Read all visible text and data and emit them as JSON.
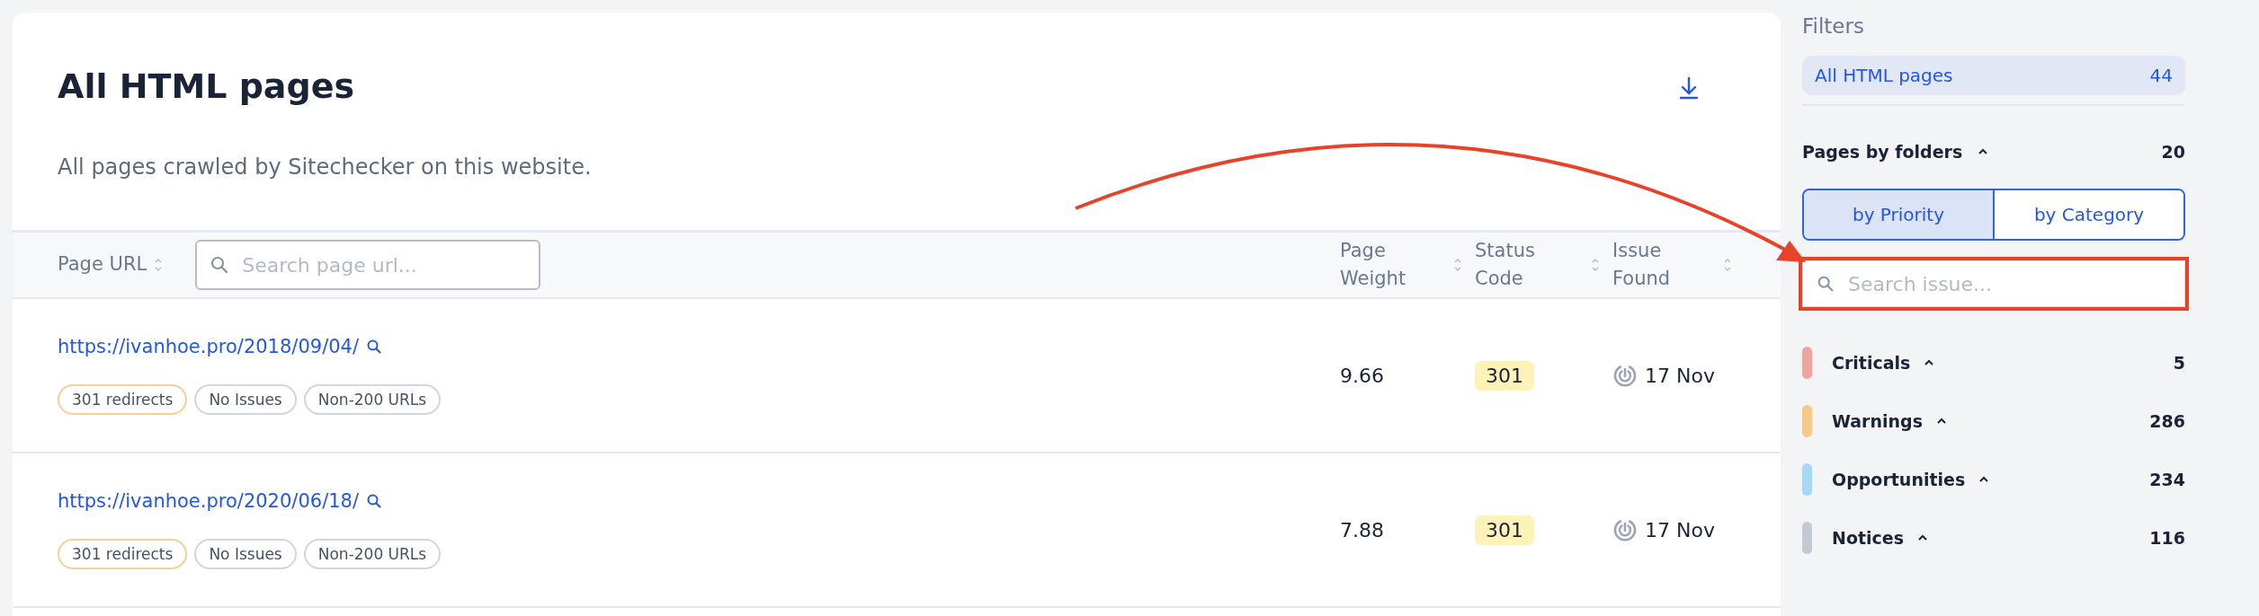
{
  "main": {
    "title": "All HTML pages",
    "subtitle": "All pages crawled by Sitechecker on this website."
  },
  "table": {
    "columns": [
      {
        "label": "Page URL",
        "sortable": true
      },
      {
        "label": "Page Weight",
        "sortable": true
      },
      {
        "label": "Status Code",
        "sortable": true
      },
      {
        "label": "Issue Found",
        "sortable": true
      }
    ],
    "search": {
      "placeholder": "Search page url..."
    },
    "rows": [
      {
        "url": "https://ivanhoe.pro/2018/09/04/",
        "tags": [
          {
            "label": "301 redirects",
            "kind": "warning"
          },
          {
            "label": "No Issues",
            "kind": "neutral"
          },
          {
            "label": "Non-200 URLs",
            "kind": "neutral"
          }
        ],
        "weight": "9.66",
        "status": "301",
        "found": "17 Nov"
      },
      {
        "url": "https://ivanhoe.pro/2020/06/18/",
        "tags": [
          {
            "label": "301 redirects",
            "kind": "warning"
          },
          {
            "label": "No Issues",
            "kind": "neutral"
          },
          {
            "label": "Non-200 URLs",
            "kind": "neutral"
          }
        ],
        "weight": "7.88",
        "status": "301",
        "found": "17 Nov"
      }
    ]
  },
  "sidebar": {
    "title": "Filters",
    "all_pages": {
      "label": "All HTML pages",
      "count": "44",
      "selected": true
    },
    "folders": {
      "label": "Pages by folders",
      "count": "20",
      "expanded": true
    },
    "tabs": [
      {
        "label": "by Priority",
        "selected": true
      },
      {
        "label": "by Category",
        "selected": false
      }
    ],
    "search": {
      "placeholder": "Search issue..."
    },
    "categories": [
      {
        "label": "Criticals",
        "count": "5",
        "color": "#eea59f",
        "expanded": true
      },
      {
        "label": "Warnings",
        "count": "286",
        "color": "#f5c98b",
        "expanded": true
      },
      {
        "label": "Opportunities",
        "count": "234",
        "color": "#a8d8f8",
        "expanded": true
      },
      {
        "label": "Notices",
        "count": "116",
        "color": "#c4cad4",
        "expanded": true
      }
    ]
  },
  "annotation": {
    "arrow": true,
    "highlight": true
  }
}
